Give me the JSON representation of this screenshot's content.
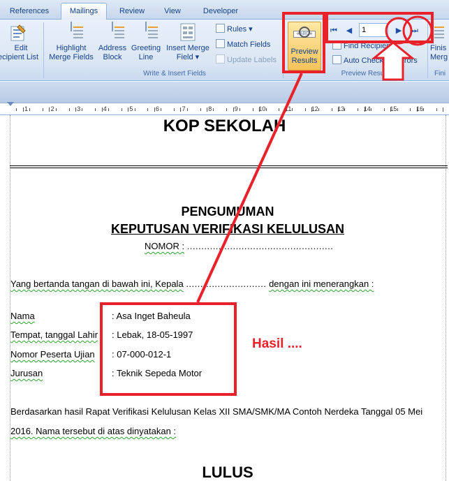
{
  "tabs": [
    {
      "label": "References",
      "active": false
    },
    {
      "label": "Mailings",
      "active": true
    },
    {
      "label": "Review",
      "active": false
    },
    {
      "label": "View",
      "active": false
    },
    {
      "label": "Developer",
      "active": false
    }
  ],
  "ribbon": {
    "edit_recipient_list": {
      "line1": "Edit",
      "line2": "ecipient List"
    },
    "highlight_merge_fields": {
      "line1": "Highlight",
      "line2": "Merge Fields"
    },
    "address_block": {
      "line1": "Address",
      "line2": "Block"
    },
    "greeting_line": {
      "line1": "Greeting",
      "line2": "Line"
    },
    "insert_merge_field": {
      "line1": "Insert Merge",
      "line2": "Field ▾"
    },
    "rules": "Rules ▾",
    "match_fields": "Match Fields",
    "update_labels": "Update Labels",
    "write_insert_group": "Write & Insert Fields",
    "preview_results": {
      "line1": "Preview",
      "line2": "Results"
    },
    "find_recipient": "Find Recipient",
    "auto_check_errors": "Auto Check for Errors",
    "preview_results_group": "Preview Result",
    "record_value": "1",
    "finish_merge": {
      "line1": "Finis",
      "line2": "Merg"
    },
    "finish_group": "Fini",
    "nav": {
      "first": "⏮",
      "previous": "◀",
      "next": "▶",
      "last": "⏭"
    }
  },
  "ruler": {
    "numbers": [
      "1",
      "2",
      "3",
      "4",
      "5",
      "6",
      "7",
      "8",
      "9",
      "10",
      "11",
      "12",
      "13",
      "14",
      "15",
      "16"
    ]
  },
  "document": {
    "kop": "KOP SEKOLAH",
    "title1": "PENGUMUMAN",
    "title2": "KEPUTUSAN VERIFIKASI KELULUSAN",
    "nomor_label": "NOMOR :",
    "nomor_dots": "...................................................",
    "intro_a": "Yang bertanda tangan di bawah ini, Kepala",
    "intro_dots": "............................",
    "intro_b": "dengan ini menerangkan :",
    "fields": [
      {
        "label": "Nama",
        "value": ": Asa Inget Baheula"
      },
      {
        "label": "Tempat, tanggal Lahir",
        "value": ": Lebak, 18-05-1997"
      },
      {
        "label": "Nomor Peserta Ujian",
        "value": ": 07-000-012-1"
      },
      {
        "label": "Jurusan",
        "value": ": Teknik Sepeda Motor"
      }
    ],
    "para1": "Berdasarkan hasil Rapat Verifikasi Kelulusan Kelas XII SMA/SMK/MA Contoh Nerdeka Tanggal 05 Mei",
    "para2": "2016. Nama tersebut di atas dinyatakan :",
    "lulus": "LULUS"
  },
  "annotation": {
    "hasil": "Hasil ....",
    "color": "#e8212a"
  },
  "colors": {
    "ribbon_text": "#15428b",
    "accent_border": "#8db2e3",
    "preview_active": "#f8c25a"
  }
}
